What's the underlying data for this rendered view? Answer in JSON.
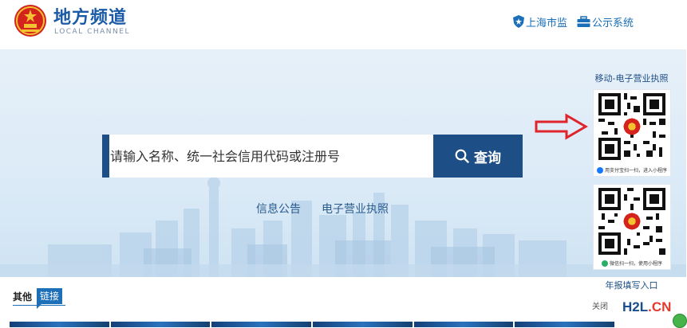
{
  "header": {
    "title": "地方频道",
    "subtitle": "LOCAL CHANNEL",
    "links": [
      {
        "label": "上海市监",
        "icon": "shield-star-icon"
      },
      {
        "label": "公示系统",
        "icon": "briefcase-icon"
      }
    ]
  },
  "search": {
    "placeholder": "请输入名称、统一社会信用代码或注册号",
    "button_label": "查询",
    "button_icon": "search-icon"
  },
  "hero_links": [
    "信息公告",
    "电子营业执照"
  ],
  "side_panel": {
    "title": "移动-电子营业执照",
    "qr_codes": [
      {
        "caption": "用支付宝扫一扫，进入小程序",
        "icon": "alipay-icon"
      },
      {
        "caption": "微信扫一扫，使用小程序",
        "icon": "wechat-icon"
      }
    ],
    "annual_report_label": "年报填写入口",
    "close_label": "关闭"
  },
  "other_links": {
    "label": "其他",
    "tag": "链接"
  },
  "watermark": {
    "h2l": "H2L",
    "dot": ".",
    "cn": "CN"
  },
  "colors": {
    "brand_blue": "#1e4e86",
    "link_blue": "#1a6fb8",
    "arrow_red": "#e0242b"
  }
}
